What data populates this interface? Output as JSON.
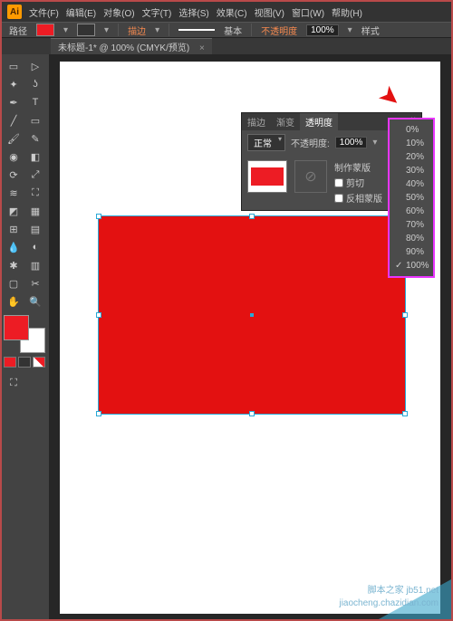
{
  "menu": {
    "items": [
      "文件(F)",
      "编辑(E)",
      "对象(O)",
      "文字(T)",
      "选择(S)",
      "效果(C)",
      "视图(V)",
      "窗口(W)",
      "帮助(H)"
    ]
  },
  "control": {
    "label": "路径",
    "fill": "#ed1c24",
    "stroke_text": "描边",
    "basic": "基本",
    "opacity_label": "不透明度",
    "opacity_value": "100%",
    "style": "样式"
  },
  "tab": {
    "title": "未标题-1* @ 100% (CMYK/预览)",
    "close": "×"
  },
  "arrow": "➤",
  "panel": {
    "tabs": [
      "描边",
      "渐变",
      "透明度"
    ],
    "active": 2,
    "close": "×",
    "blend_mode": "正常",
    "opacity_label": "不透明度:",
    "opacity_value": "100%",
    "make_mask": "制作蒙版",
    "clip": "剪切",
    "invert": "反相蒙版",
    "mask_icon": "⊘"
  },
  "opacity_menu": {
    "items": [
      "0%",
      "10%",
      "20%",
      "30%",
      "40%",
      "50%",
      "60%",
      "70%",
      "80%",
      "90%",
      "100%"
    ],
    "selected": 10,
    "check": "✓"
  },
  "colors": {
    "fg": "#ed1c24",
    "bg": "#ffffff"
  },
  "watermark": {
    "line1": "脚本之家 jb51.net",
    "line2": "jiaocheng.chazidian.com"
  }
}
